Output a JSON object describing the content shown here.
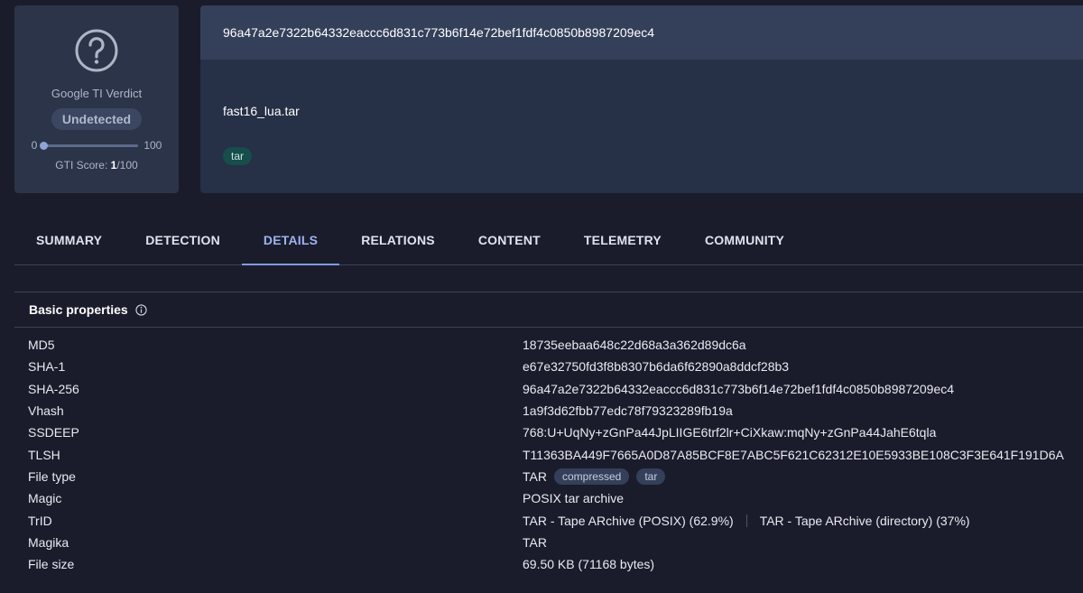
{
  "verdict": {
    "label": "Google TI Verdict",
    "status": "Undetected",
    "score_min": "0",
    "score_max": "100",
    "score_value": 1,
    "score_prefix": "GTI Score: ",
    "score_number": "1",
    "score_suffix": "/100"
  },
  "header": {
    "hash": "96a47a2e7322b64332eaccc6d831c773b6f14e72bef1fdf4c0850b8987209ec4",
    "file_name": "fast16_lua.tar",
    "tag": "tar"
  },
  "tabs": [
    {
      "label": "SUMMARY"
    },
    {
      "label": "DETECTION"
    },
    {
      "label": "DETAILS"
    },
    {
      "label": "RELATIONS"
    },
    {
      "label": "CONTENT"
    },
    {
      "label": "TELEMETRY"
    },
    {
      "label": "COMMUNITY"
    }
  ],
  "active_tab": "DETAILS",
  "section": {
    "title": "Basic properties"
  },
  "props": {
    "md5": {
      "key": "MD5",
      "value": "18735eebaa648c22d68a3a362d89dc6a"
    },
    "sha1": {
      "key": "SHA-1",
      "value": "e67e32750fd3f8b8307b6da6f62890a8ddcf28b3"
    },
    "sha256": {
      "key": "SHA-256",
      "value": "96a47a2e7322b64332eaccc6d831c773b6f14e72bef1fdf4c0850b8987209ec4"
    },
    "vhash": {
      "key": "Vhash",
      "value": "1a9f3d62fbb77edc78f79323289fb19a"
    },
    "ssdeep": {
      "key": "SSDEEP",
      "value": "768:U+UqNy+zGnPa44JpLIIGE6trf2lr+CiXkaw:mqNy+zGnPa44JahE6tqla"
    },
    "tlsh": {
      "key": "TLSH",
      "value": "T11363BA449F7665A0D87A85BCF8E7ABC5F621C62312E10E5933BE108C3F3E641F191D6A"
    },
    "filetype": {
      "key": "File type",
      "value": "TAR",
      "chips": [
        "compressed",
        "tar"
      ]
    },
    "magic": {
      "key": "Magic",
      "value": "POSIX tar archive"
    },
    "trid": {
      "key": "TrID",
      "value1": "TAR - Tape ARchive (POSIX) (62.9%)",
      "value2": "TAR - Tape ARchive (directory) (37%)"
    },
    "magika": {
      "key": "Magika",
      "value": "TAR"
    },
    "filesize": {
      "key": "File size",
      "value": "69.50 KB (71168 bytes)"
    }
  },
  "colors": {
    "background": "#1b1c2b",
    "card": "#2b3448",
    "accent": "#7f9be0",
    "tag_bg": "#174d4a"
  }
}
